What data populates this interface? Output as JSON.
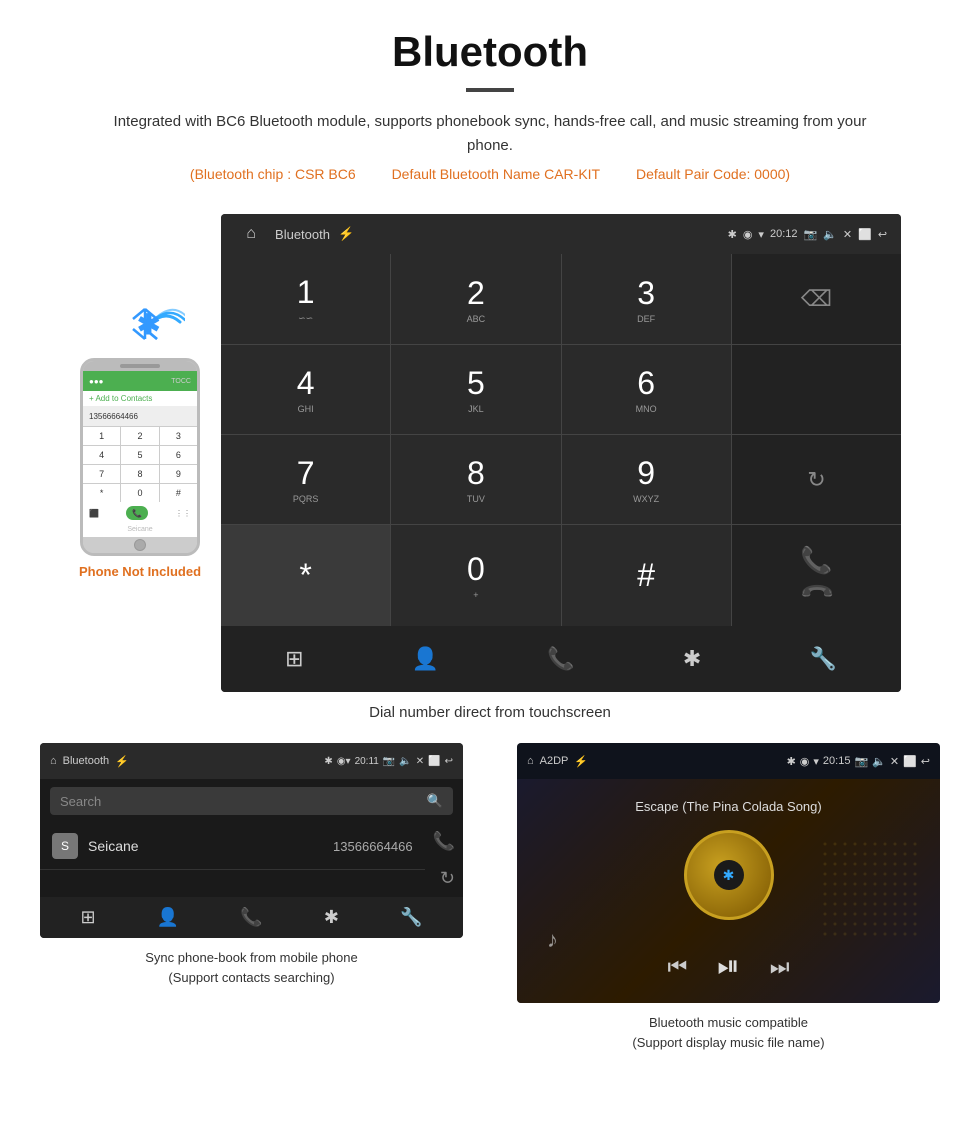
{
  "header": {
    "title": "Bluetooth",
    "description": "Integrated with BC6 Bluetooth module, supports phonebook sync, hands-free call, and music streaming from your phone.",
    "specs": [
      "(Bluetooth chip : CSR BC6",
      "Default Bluetooth Name CAR-KIT",
      "Default Pair Code: 0000)"
    ]
  },
  "phone_side": {
    "label": "Phone Not Included",
    "wifi_symbol": "📶",
    "dialpad": [
      "1",
      "2",
      "3",
      "4",
      "5",
      "6",
      "7",
      "8",
      "9",
      "*",
      "0",
      "#"
    ],
    "watermark": "Seicane"
  },
  "dial_screen": {
    "status_bar": {
      "title": "Bluetooth",
      "time": "20:12"
    },
    "keys": [
      {
        "number": "1",
        "letters": "oo"
      },
      {
        "number": "2",
        "letters": "ABC"
      },
      {
        "number": "3",
        "letters": "DEF"
      },
      {
        "number": "",
        "letters": "",
        "action": "backspace"
      },
      {
        "number": "4",
        "letters": "GHI"
      },
      {
        "number": "5",
        "letters": "JKL"
      },
      {
        "number": "6",
        "letters": "MNO"
      },
      {
        "number": "",
        "letters": "",
        "action": "empty"
      },
      {
        "number": "7",
        "letters": "PQRS"
      },
      {
        "number": "8",
        "letters": "TUV"
      },
      {
        "number": "9",
        "letters": "WXYZ"
      },
      {
        "number": "",
        "letters": "",
        "action": "redial"
      },
      {
        "number": "*",
        "letters": ""
      },
      {
        "number": "0",
        "letters": "+"
      },
      {
        "number": "#",
        "letters": ""
      },
      {
        "number": "",
        "letters": "",
        "action": "call_green"
      },
      {
        "number": "",
        "letters": "",
        "action": "call_red"
      }
    ],
    "bottom_icons": [
      "dialpad",
      "contacts",
      "phone",
      "bluetooth",
      "wrench"
    ],
    "caption": "Dial number direct from touchscreen"
  },
  "phonebook_screen": {
    "status_bar": {
      "title": "Bluetooth",
      "time": "20:11"
    },
    "search_placeholder": "Search",
    "contacts": [
      {
        "initial": "S",
        "name": "Seicane",
        "phone": "13566664466"
      }
    ],
    "right_icons": [
      "phone",
      "refresh"
    ],
    "bottom_icons": [
      "dialpad",
      "person",
      "phone",
      "bluetooth",
      "wrench"
    ],
    "caption_line1": "Sync phone-book from mobile phone",
    "caption_line2": "(Support contacts searching)"
  },
  "music_screen": {
    "status_bar": {
      "title": "A2DP",
      "time": "20:15"
    },
    "song_title": "Escape (The Pina Colada Song)",
    "controls": [
      "skip-prev",
      "play-pause",
      "skip-next"
    ],
    "caption_line1": "Bluetooth music compatible",
    "caption_line2": "(Support display music file name)"
  }
}
